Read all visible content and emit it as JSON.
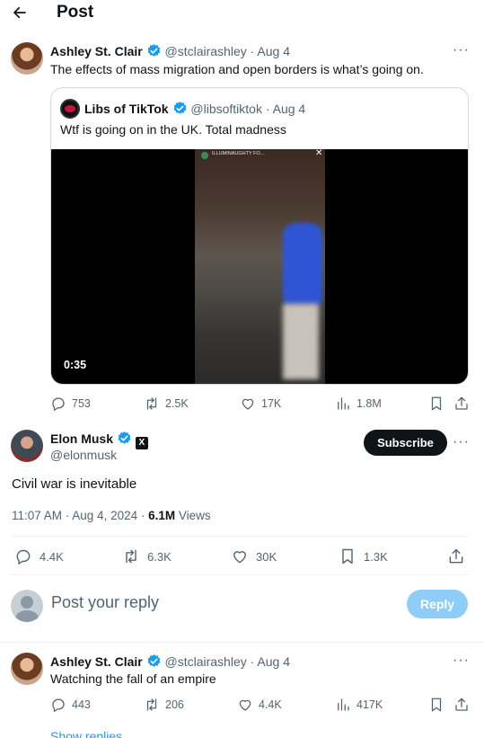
{
  "header": {
    "title": "Post"
  },
  "parent_post": {
    "author_name": "Ashley St. Clair",
    "handle_time": "@stclairashley · Aug 4",
    "text": "The effects of mass migration and open borders is what’s going on.",
    "quote": {
      "author_name": "Libs of TikTok",
      "handle_time": "@libsoftiktok · Aug 4",
      "text": "Wtf is going on in the UK. Total madness",
      "video_duration": "0:35",
      "video_top_label": "ILLUMINAUGHTY FO..."
    },
    "actions": {
      "replies": "753",
      "reposts": "2.5K",
      "likes": "17K",
      "views": "1.8M"
    }
  },
  "main_post": {
    "author_name": "Elon Musk",
    "handle": "@elonmusk",
    "subscribe_label": "Subscribe",
    "text": "Civil war is inevitable",
    "timestamp": "11:07 AM · Aug 4, 2024 · ",
    "views_count": "6.1M",
    "views_label": " Views",
    "actions": {
      "replies": "4.4K",
      "reposts": "6.3K",
      "likes": "30K",
      "bookmarks": "1.3K"
    }
  },
  "reply_box": {
    "placeholder": "Post your reply",
    "button_label": "Reply"
  },
  "reply_post": {
    "author_name": "Ashley St. Clair",
    "handle_time": "@stclairashley · Aug 4",
    "text": "Watching the fall of an empire",
    "actions": {
      "replies": "443",
      "reposts": "206",
      "likes": "4.4K",
      "views": "417K"
    },
    "show_replies": "Show replies"
  },
  "colors": {
    "accent": "#1d9bf0",
    "reply_button_disabled": "#8ecdf8",
    "text": "#0f1419",
    "muted": "#536471"
  }
}
